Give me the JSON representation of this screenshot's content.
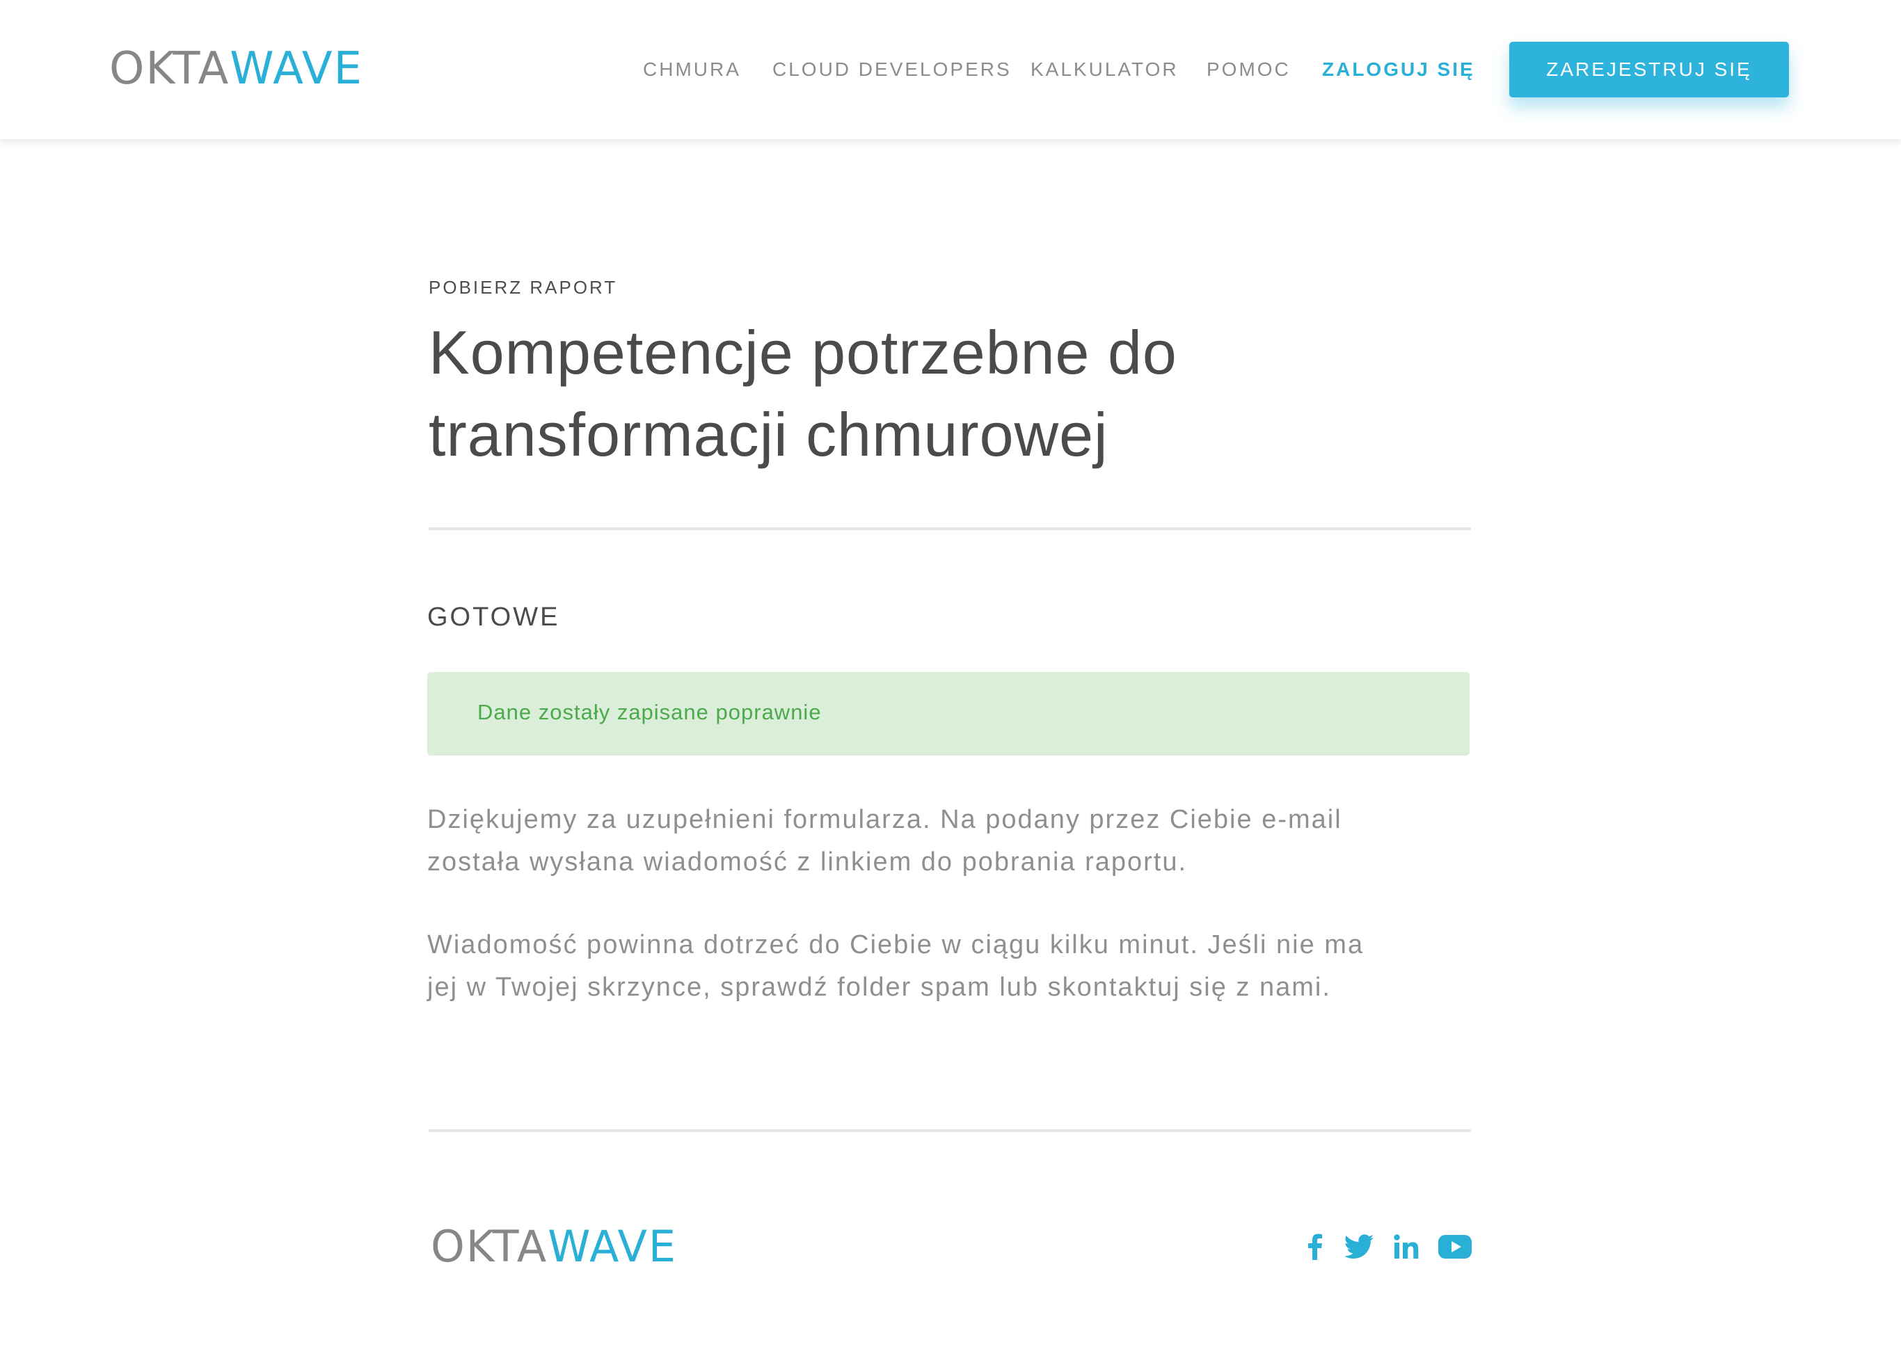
{
  "header": {
    "logo": {
      "part1": "OKTA",
      "part2": "WAVE"
    },
    "nav": [
      {
        "label": "CHMURA"
      },
      {
        "label": "CLOUD DEVELOPERS"
      },
      {
        "label": "KALKULATOR"
      },
      {
        "label": "POMOC"
      },
      {
        "label": "ZALOGUJ SIĘ"
      }
    ],
    "register_button": "ZAREJESTRUJ SIĘ"
  },
  "main": {
    "eyebrow": "POBIERZ RAPORT",
    "title_line1": "Kompetencje potrzebne do",
    "title_line2": "transformacji chmurowej",
    "status_heading": "GOTOWE",
    "alert": "Dane zostały zapisane poprawnie",
    "paragraph1_line1": "Dziękujemy za uzupełnieni formularza. Na podany przez Ciebie e-mail",
    "paragraph1_line2": "została wysłana wiadomość z linkiem do pobrania raportu.",
    "paragraph2_line1": "Wiadomość powinna dotrzeć do Ciebie w ciągu kilku minut. Jeśli nie ma",
    "paragraph2_line2": "jej w Twojej skrzynce, sprawdź folder spam lub skontaktuj się z nami."
  },
  "footer": {
    "logo": {
      "part1": "OKTA",
      "part2": "WAVE"
    },
    "social": [
      {
        "icon": "facebook-icon"
      },
      {
        "icon": "twitter-icon"
      },
      {
        "icon": "linkedin-icon"
      },
      {
        "icon": "youtube-icon"
      }
    ]
  },
  "colors": {
    "accent": "#2aafd6",
    "logo_gray": "#878787",
    "alert_bg": "#dbeeda",
    "alert_text": "#4caa4c",
    "body_text": "#8f8f8f",
    "heading_text": "#4b4b4b"
  }
}
